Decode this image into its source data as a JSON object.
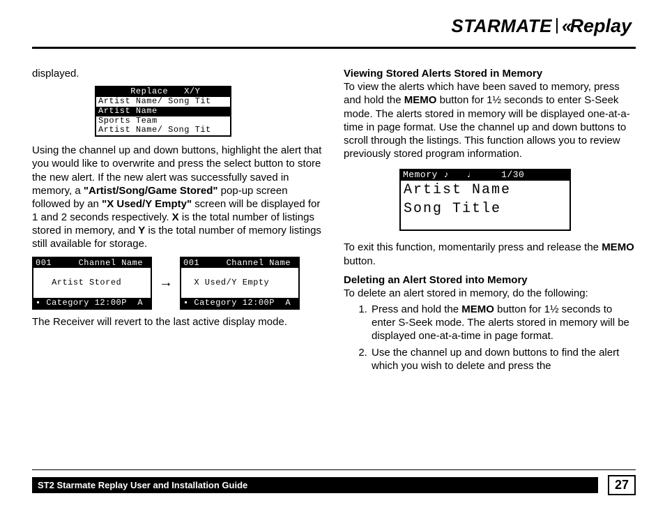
{
  "header": {
    "brand_left": "STARMATE",
    "brand_right": "Replay"
  },
  "left": {
    "p1": "displayed.",
    "lcd1": {
      "r1": "      Replace   X/Y",
      "r2": "Artist Name/ Song Tit",
      "r3": "Artist Name",
      "r4": "Sports Team",
      "r5": "Artist Name/ Song Tit"
    },
    "p2_a": "Using the channel up and down buttons, highlight the alert that you would like to overwrite and press the select button to store the new alert. If the new alert was successfully saved in memory, a ",
    "p2_b": "\"Artist/Song/Game Stored\"",
    "p2_c": " pop-up screen followed by an ",
    "p2_d": "\"X Used/Y Empty\"",
    "p2_e": " screen will be displayed for 1 and 2 seconds respectively. ",
    "p2_f": "X",
    "p2_g": " is the total number of listings stored in memory, and ",
    "p2_h": "Y",
    "p2_i": " is the total number of memory listings still available for storage.",
    "lcd2": {
      "top": "001     Channel Name",
      "mid": "   Artist Stored    ",
      "bot": "▪ Category 12:00P  A"
    },
    "lcd3": {
      "top": "001     Channel Name",
      "mid": "  X Used/Y Empty    ",
      "bot": "▪ Category 12:00P  A"
    },
    "p3": "The Receiver will revert to the last active display mode."
  },
  "right": {
    "h1": "Viewing Stored Alerts Stored in Memory",
    "p1_a": "To view the alerts which have been saved to memory, press and hold the ",
    "p1_b": "MEMO",
    "p1_c": " button for 1½ seconds to enter S-Seek mode. The alerts stored in memory will be displayed one-at-a-time in page format. Use the channel up and down buttons to scroll through the listings. This function allows you to review previously stored program information.",
    "lcd": {
      "top": "Memory ♪   ♩     1/30",
      "l1": "Artist Name",
      "l2": "Song Title"
    },
    "p2_a": "To exit this function, momentarily press and release the ",
    "p2_b": "MEMO",
    "p2_c": " button.",
    "h2": "Deleting an Alert Stored into Memory",
    "p3": "To delete an alert stored in memory, do the following:",
    "li1_a": "Press and hold the ",
    "li1_b": "MEMO",
    "li1_c": " button for 1½ seconds to enter S-Seek mode. The alerts stored in memory will be displayed one-at-a-time in page format.",
    "li2": "Use the channel up and down buttons to find the alert which you wish to delete and press the"
  },
  "footer": {
    "bar": "ST2 Starmate Replay User and Installation Guide",
    "page": "27"
  }
}
